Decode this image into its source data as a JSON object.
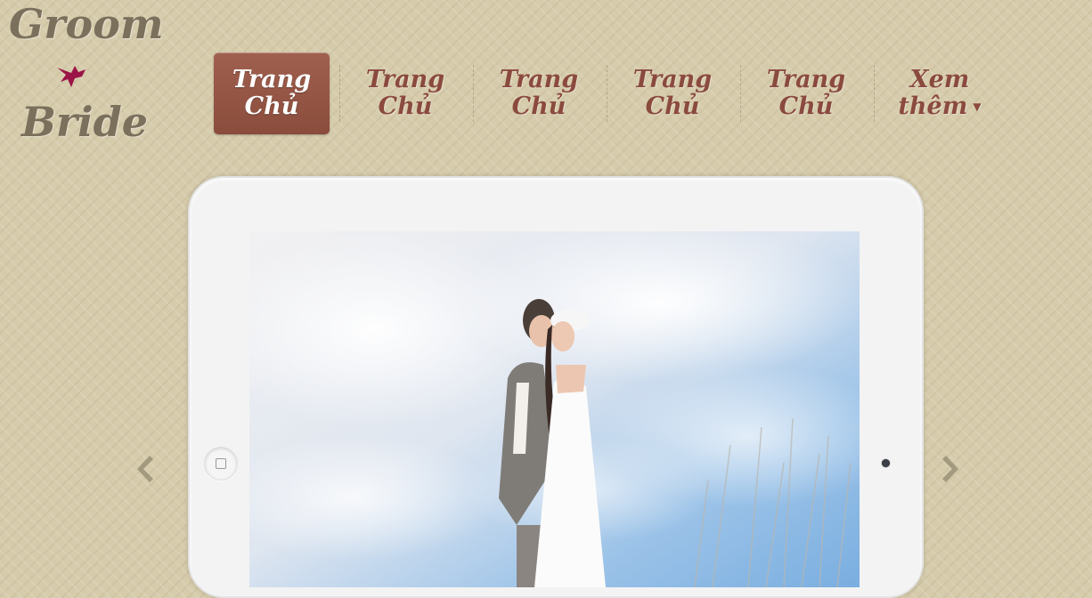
{
  "logo": {
    "top_word": "Groom",
    "bottom_word": "Bride",
    "icon": "bird-icon",
    "icon_color": "#9b1447"
  },
  "nav": {
    "items": [
      {
        "label_line1": "Trang",
        "label_line2": "Chủ",
        "active": true
      },
      {
        "label_line1": "Trang",
        "label_line2": "Chủ",
        "active": false
      },
      {
        "label_line1": "Trang",
        "label_line2": "Chủ",
        "active": false
      },
      {
        "label_line1": "Trang",
        "label_line2": "Chủ",
        "active": false
      },
      {
        "label_line1": "Trang",
        "label_line2": "Chủ",
        "active": false
      },
      {
        "label_line1": "Xem",
        "label_line2": "thêm",
        "active": false,
        "dropdown": true
      }
    ]
  },
  "slider": {
    "prev_icon": "chevron-left-icon",
    "next_icon": "chevron-right-icon",
    "device_home_icon": "home-button-icon",
    "image": "wedding-couple-photo"
  },
  "colors": {
    "background": "#d6ccac",
    "nav_text": "#8b4a3e",
    "nav_active_bg": "#9a5b4a",
    "logo_text": "#7a705c"
  }
}
